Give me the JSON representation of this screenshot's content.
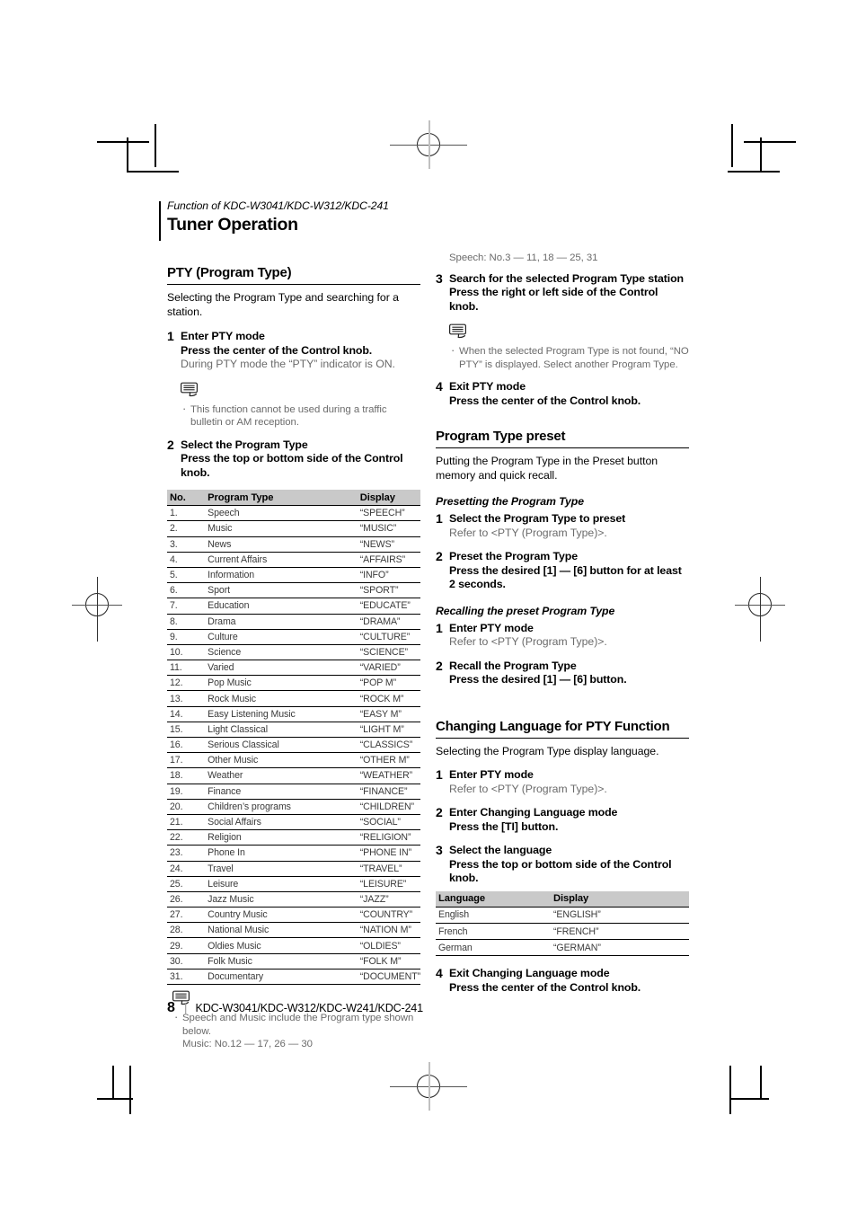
{
  "header": {
    "function_line": "Function of KDC-W3041/KDC-W312/KDC-241",
    "chapter_title": "Tuner Operation"
  },
  "pty_section": {
    "heading": "PTY (Program Type)",
    "intro": "Selecting the Program Type and searching for a station.",
    "steps": [
      {
        "num": "1",
        "title": "Enter PTY mode",
        "action": "Press the center of the Control knob.",
        "note": "During PTY mode the “PTY” indicator is ON.",
        "bullets": [
          "This function cannot be used during a traffic bulletin or AM reception."
        ]
      },
      {
        "num": "2",
        "title": "Select the Program Type",
        "action": "Press the top or bottom side of the Control knob."
      },
      {
        "num": "3",
        "title": "Search for the selected Program Type station",
        "action": "Press the right or left side of the Control knob.",
        "bullets": [
          "When the selected Program Type is not found, “NO PTY” is displayed. Select another Program Type."
        ]
      },
      {
        "num": "4",
        "title": "Exit PTY mode",
        "action": "Press the center of the Control knob."
      }
    ],
    "table": {
      "columns": [
        "No.",
        "Program Type",
        "Display"
      ],
      "rows": [
        [
          "1.",
          "Speech",
          "“SPEECH”"
        ],
        [
          "2.",
          "Music",
          "“MUSIC”"
        ],
        [
          "3.",
          "News",
          "“NEWS”"
        ],
        [
          "4.",
          "Current Affairs",
          "“AFFAIRS”"
        ],
        [
          "5.",
          "Information",
          "“INFO”"
        ],
        [
          "6.",
          "Sport",
          "“SPORT”"
        ],
        [
          "7.",
          "Education",
          "“EDUCATE”"
        ],
        [
          "8.",
          "Drama",
          "“DRAMA”"
        ],
        [
          "9.",
          "Culture",
          "“CULTURE”"
        ],
        [
          "10.",
          "Science",
          "“SCIENCE”"
        ],
        [
          "11.",
          "Varied",
          "“VARIED”"
        ],
        [
          "12.",
          "Pop Music",
          "“POP M”"
        ],
        [
          "13.",
          "Rock Music",
          "“ROCK M”"
        ],
        [
          "14.",
          "Easy Listening Music",
          "“EASY M”"
        ],
        [
          "15.",
          "Light Classical",
          "“LIGHT M”"
        ],
        [
          "16.",
          "Serious Classical",
          "“CLASSICS”"
        ],
        [
          "17.",
          "Other Music",
          "“OTHER M”"
        ],
        [
          "18.",
          "Weather",
          "“WEATHER”"
        ],
        [
          "19.",
          "Finance",
          "“FINANCE”"
        ],
        [
          "20.",
          "Children’s programs",
          "“CHILDREN”"
        ],
        [
          "21.",
          "Social Affairs",
          "“SOCIAL”"
        ],
        [
          "22.",
          "Religion",
          "“RELIGION”"
        ],
        [
          "23.",
          "Phone In",
          "“PHONE IN”"
        ],
        [
          "24.",
          "Travel",
          "“TRAVEL”"
        ],
        [
          "25.",
          "Leisure",
          "“LEISURE”"
        ],
        [
          "26.",
          "Jazz Music",
          "“JAZZ”"
        ],
        [
          "27.",
          "Country Music",
          "“COUNTRY”"
        ],
        [
          "28.",
          "National Music",
          "“NATION M”"
        ],
        [
          "29.",
          "Oldies Music",
          "“OLDIES”"
        ],
        [
          "30.",
          "Folk Music",
          "“FOLK M”"
        ],
        [
          "31.",
          "Documentary",
          "“DOCUMENT”"
        ]
      ]
    },
    "table_note": {
      "bullet": "Speech and Music include the Program type shown below.",
      "music_line": "Music: No.12 — 17, 26 — 30",
      "speech_line": "Speech: No.3 — 11, 18 — 25, 31"
    }
  },
  "preset_section": {
    "heading": "Program Type preset",
    "intro": "Putting the Program Type in the Preset button memory and quick recall.",
    "sub1": "Presetting the Program Type",
    "sub1_steps": [
      {
        "num": "1",
        "title": "Select the Program Type to preset",
        "note": "Refer to <PTY (Program Type)>."
      },
      {
        "num": "2",
        "title": "Preset the Program Type",
        "action": "Press the desired [1] — [6] button for at least 2 seconds."
      }
    ],
    "sub2": "Recalling the preset Program Type",
    "sub2_steps": [
      {
        "num": "1",
        "title": "Enter PTY mode",
        "note": "Refer to <PTY (Program Type)>."
      },
      {
        "num": "2",
        "title": "Recall the Program Type",
        "action": "Press the desired [1] — [6] button."
      }
    ]
  },
  "language_section": {
    "heading": "Changing Language for PTY Function",
    "intro": "Selecting the Program Type display language.",
    "steps": [
      {
        "num": "1",
        "title": "Enter PTY mode",
        "note": "Refer to <PTY (Program Type)>."
      },
      {
        "num": "2",
        "title": "Enter Changing Language mode",
        "action": "Press the [TI] button."
      },
      {
        "num": "3",
        "title": "Select the language",
        "action": "Press the top or bottom side of the Control knob."
      },
      {
        "num": "4",
        "title": "Exit Changing Language mode",
        "action": "Press the center of the Control knob."
      }
    ],
    "table": {
      "columns": [
        "Language",
        "Display"
      ],
      "rows": [
        [
          "English",
          "“ENGLISH”"
        ],
        [
          "French",
          "“FRENCH”"
        ],
        [
          "German",
          "“GERMAN”"
        ]
      ]
    }
  },
  "footer": {
    "page_number": "8",
    "separator": "|",
    "models": "KDC-W3041/KDC-W312/KDC-W241/KDC-241"
  },
  "icons": {
    "note_bubble": "note-speech-bubble-icon"
  }
}
